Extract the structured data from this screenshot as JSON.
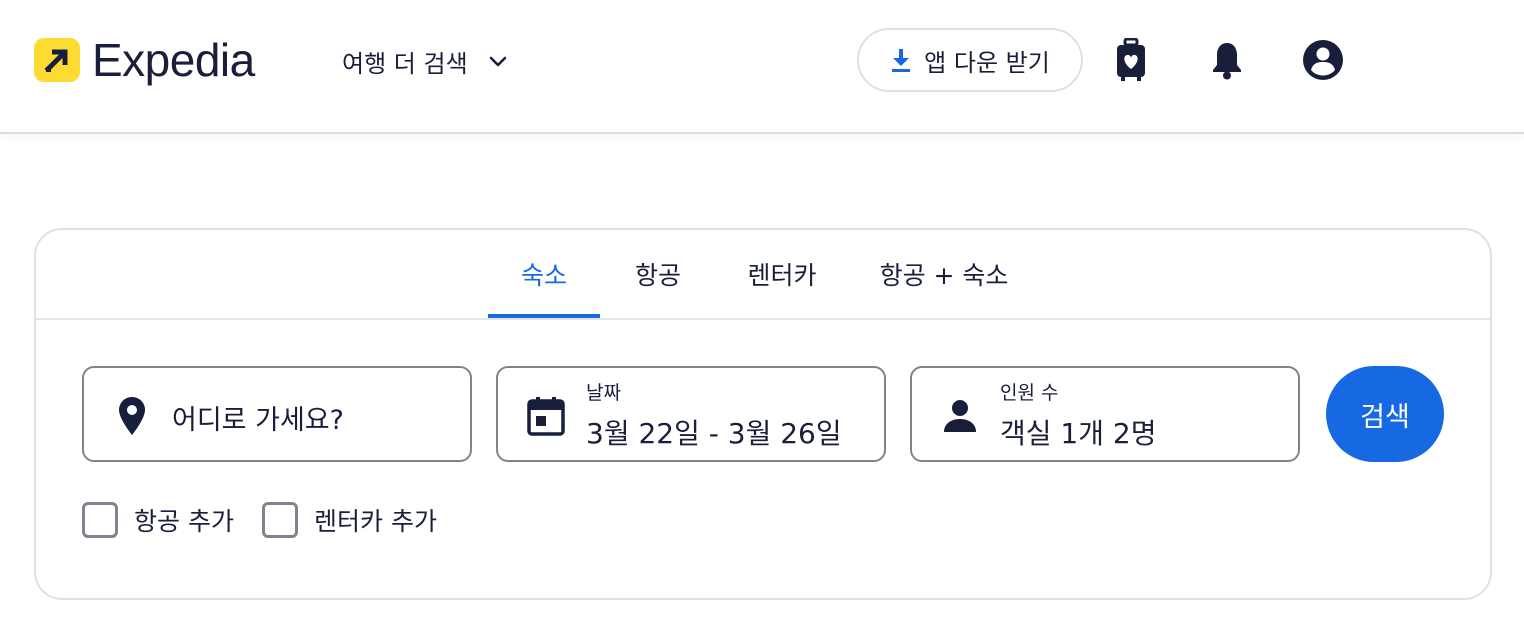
{
  "header": {
    "brand": "Expedia",
    "more_travel_label": "여행 더 검색",
    "app_download_label": "앱 다운 받기",
    "icons": [
      "download-icon",
      "trips-icon",
      "bell-icon",
      "account-icon",
      "chevron-down-icon"
    ]
  },
  "tabs": [
    {
      "label": "숙소",
      "active": true
    },
    {
      "label": "항공",
      "active": false
    },
    {
      "label": "렌터카",
      "active": false
    },
    {
      "label": "항공 + 숙소",
      "active": false
    }
  ],
  "search": {
    "destination_placeholder": "어디로 가세요?",
    "dates_label": "날짜",
    "dates_value": "3월 22일 - 3월 26일",
    "travelers_label": "인원 수",
    "travelers_value": "객실 1개 2명",
    "search_button": "검색"
  },
  "addons": [
    {
      "label": "항공 추가",
      "checked": false
    },
    {
      "label": "렌터카 추가",
      "checked": false
    }
  ],
  "colors": {
    "brand_yellow": "#fddb32",
    "accent_blue": "#1668e3",
    "text_dark": "#191e3b",
    "border_gray": "#81838f"
  }
}
